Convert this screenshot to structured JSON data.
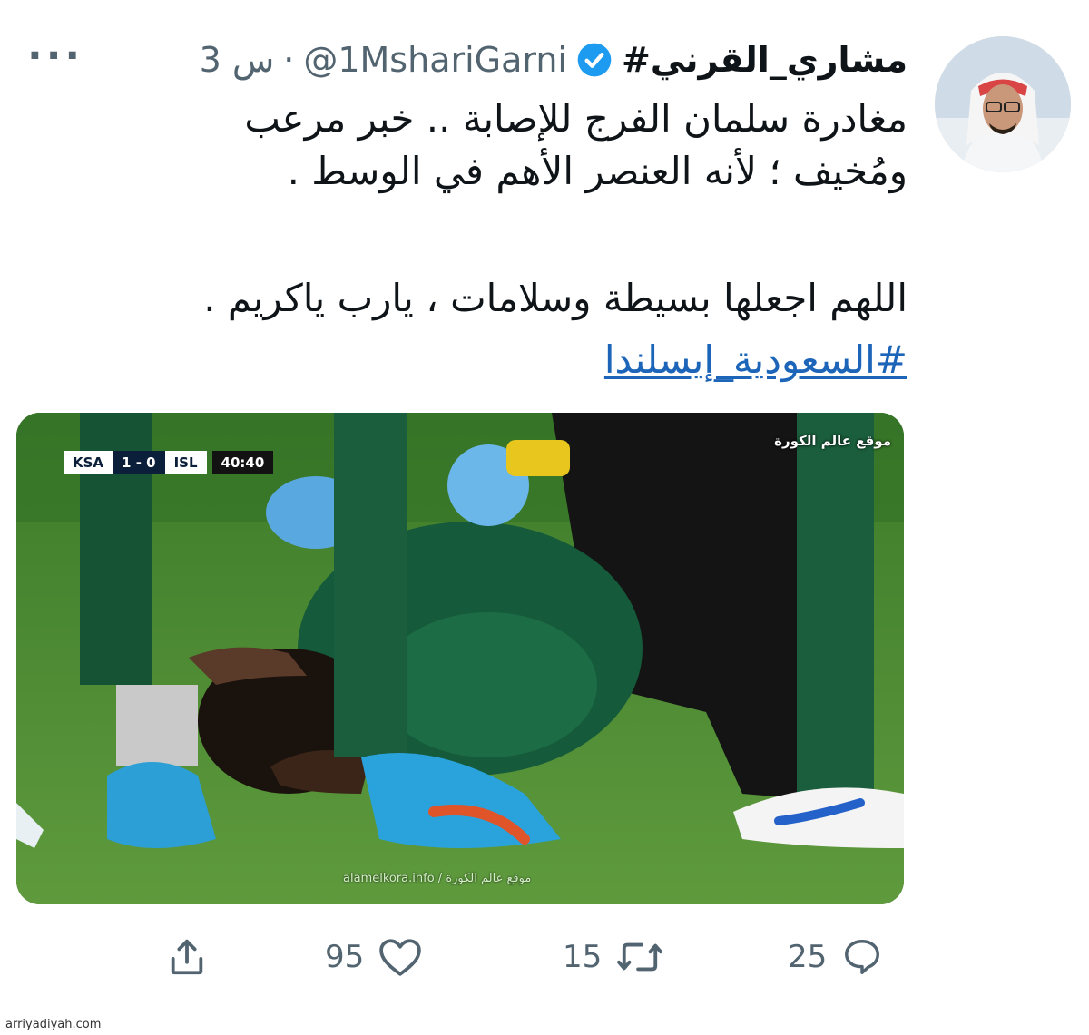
{
  "tweet": {
    "display_name": "#مشاري_القرني",
    "handle": "@1MshariGarni",
    "separator": "·",
    "time": "3 س",
    "more_label": "···",
    "lines": [
      "مغادرة سلمان الفرج للإصابة .. خبر مرعب",
      "ومُخيف ؛ لأنه العنصر الأهم في الوسط .",
      "اللهم اجعلها بسيطة وسلامات ، يارب ياكريم ."
    ],
    "hashtag": "#السعودية_إيسلندا"
  },
  "media": {
    "scoreboard": {
      "home": "KSA",
      "score": "1 - 0",
      "away": "ISL",
      "clock": "40:40"
    },
    "watermark_top": "موقع عالم الكورة",
    "watermark_bottom": "alamelkora.info / موقع عالم الكورة"
  },
  "actions": {
    "replies": "25",
    "retweets": "15",
    "likes": "95"
  },
  "footer": {
    "credit": "arriyadiyah.com"
  },
  "colors": {
    "text": "#0f1419",
    "secondary": "#536471",
    "link": "#1d65b8",
    "verified": "#1d9bf0"
  },
  "icons": {
    "verified": "verified-badge-icon",
    "reply": "reply-icon",
    "retweet": "retweet-icon",
    "like": "like-icon",
    "share": "share-icon",
    "more": "more-icon"
  }
}
